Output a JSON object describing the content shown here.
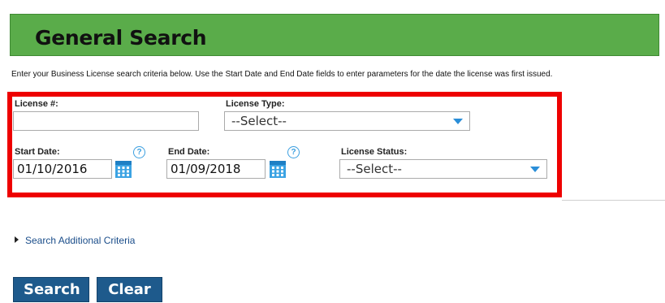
{
  "header": {
    "title": "General Search"
  },
  "instructions": "Enter your Business License search criteria below.  Use the Start Date and End Date fields to enter parameters for the date the license was first issued.",
  "form": {
    "license_number": {
      "label": "License #:",
      "value": ""
    },
    "license_type": {
      "label": "License Type:",
      "selected": "--Select--"
    },
    "start_date": {
      "label": "Start Date:",
      "value": "01/10/2016"
    },
    "end_date": {
      "label": "End Date:",
      "value": "01/09/2018"
    },
    "license_status": {
      "label": "License Status:",
      "selected": "--Select--"
    }
  },
  "help_icon_glyph": "?",
  "additional_criteria": "Search Additional Criteria",
  "buttons": {
    "search": "Search",
    "clear": "Clear"
  },
  "colors": {
    "header_green": "#5aac4a",
    "highlight_red": "#ee0000",
    "button_blue": "#1e5a8c",
    "accent_blue": "#2a8ed8"
  }
}
